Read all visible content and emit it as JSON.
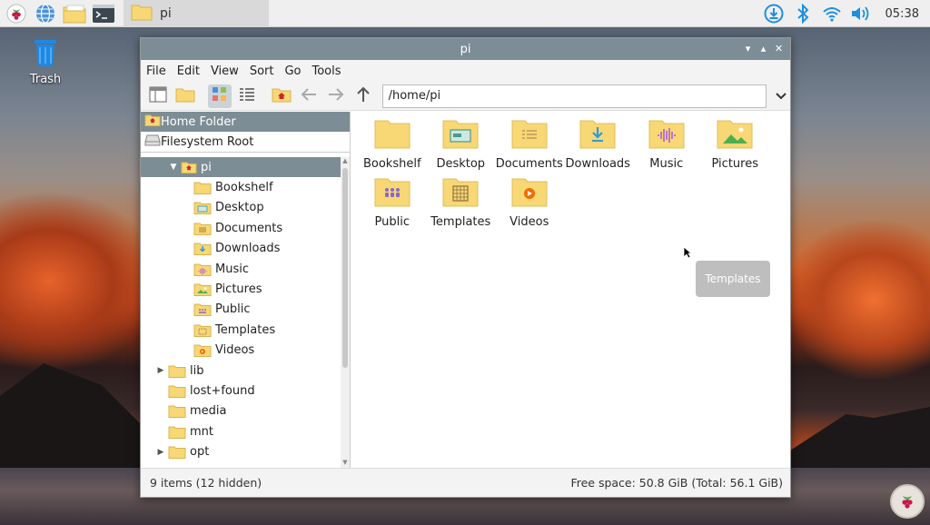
{
  "taskbar": {
    "apps": [
      {
        "icon": "raspberry-menu-icon"
      },
      {
        "icon": "web-browser-icon"
      },
      {
        "icon": "file-manager-icon"
      },
      {
        "icon": "terminal-icon"
      }
    ],
    "task_label": "pi",
    "tray": [
      "updates-icon",
      "bluetooth-icon",
      "wifi-icon",
      "volume-icon"
    ],
    "clock": "05:38"
  },
  "desktop": {
    "trash_label": "Trash"
  },
  "window": {
    "title": "pi",
    "menu": [
      "File",
      "Edit",
      "View",
      "Sort",
      "Go",
      "Tools"
    ],
    "path": "/home/pi",
    "places": [
      {
        "label": "Home Folder",
        "icon": "home-icon",
        "selected": true
      },
      {
        "label": "Filesystem Root",
        "icon": "drive-icon",
        "selected": false
      }
    ],
    "tree": [
      {
        "label": "pi",
        "expanded": true,
        "selected": true,
        "icon": "home-folder"
      },
      {
        "label": "Bookshelf",
        "icon": "folder"
      },
      {
        "label": "Desktop",
        "icon": "desktop-folder"
      },
      {
        "label": "Documents",
        "icon": "documents-folder"
      },
      {
        "label": "Downloads",
        "icon": "downloads-folder"
      },
      {
        "label": "Music",
        "icon": "music-folder"
      },
      {
        "label": "Pictures",
        "icon": "pictures-folder"
      },
      {
        "label": "Public",
        "icon": "public-folder"
      },
      {
        "label": "Templates",
        "icon": "templates-folder"
      },
      {
        "label": "Videos",
        "icon": "videos-folder"
      },
      {
        "label": "lib",
        "icon": "folder",
        "expander": true
      },
      {
        "label": "lost+found",
        "icon": "folder"
      },
      {
        "label": "media",
        "icon": "folder"
      },
      {
        "label": "mnt",
        "icon": "folder"
      },
      {
        "label": "opt",
        "icon": "folder",
        "expander": true
      }
    ],
    "items": [
      {
        "label": "Bookshelf",
        "icon": "folder"
      },
      {
        "label": "Desktop",
        "icon": "desktop-folder"
      },
      {
        "label": "Documents",
        "icon": "documents-folder"
      },
      {
        "label": "Downloads",
        "icon": "downloads-folder"
      },
      {
        "label": "Music",
        "icon": "music-folder"
      },
      {
        "label": "Pictures",
        "icon": "pictures-folder"
      },
      {
        "label": "Public",
        "icon": "public-folder"
      },
      {
        "label": "Templates",
        "icon": "templates-folder"
      },
      {
        "label": "Videos",
        "icon": "videos-folder"
      }
    ],
    "tooltip": "Templates",
    "status_left": "9 items (12 hidden)",
    "status_right": "Free space: 50.8 GiB (Total: 56.1 GiB)"
  },
  "colors": {
    "accent": "#7d8d95",
    "folder": "#f8d775",
    "folder_dark": "#e8c25a"
  }
}
